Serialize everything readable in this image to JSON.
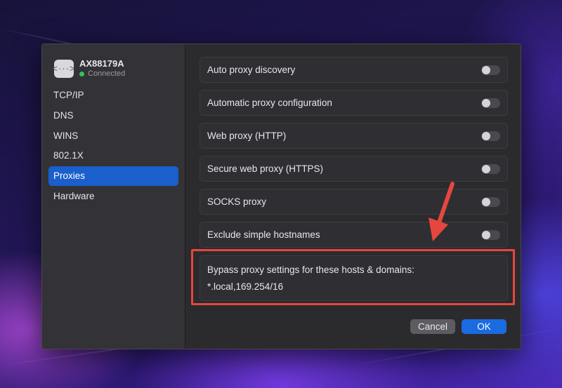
{
  "device": {
    "name": "AX88179A",
    "status": "Connected",
    "icon": "ethernet-adapter-icon",
    "status_color": "#2fc55a"
  },
  "sidebar": {
    "items": [
      {
        "label": "TCP/IP",
        "active": false
      },
      {
        "label": "DNS",
        "active": false
      },
      {
        "label": "WINS",
        "active": false
      },
      {
        "label": "802.1X",
        "active": false
      },
      {
        "label": "Proxies",
        "active": true
      },
      {
        "label": "Hardware",
        "active": false
      }
    ]
  },
  "proxies": {
    "rows": [
      {
        "label": "Auto proxy discovery",
        "enabled": false
      },
      {
        "label": "Automatic proxy configuration",
        "enabled": false
      },
      {
        "label": "Web proxy (HTTP)",
        "enabled": false
      },
      {
        "label": "Secure web proxy (HTTPS)",
        "enabled": false
      },
      {
        "label": "SOCKS proxy",
        "enabled": false
      },
      {
        "label": "Exclude simple hostnames",
        "enabled": false
      }
    ],
    "bypass_label": "Bypass proxy settings for these hosts & domains:",
    "bypass_value": "*.local,169.254/16"
  },
  "buttons": {
    "cancel": "Cancel",
    "ok": "OK"
  },
  "annotation": {
    "highlight_color": "#e5473f",
    "arrow_icon": "arrow-down-left-icon"
  },
  "colors": {
    "accent": "#1a5fcc",
    "ok_button": "#1a6be0"
  }
}
